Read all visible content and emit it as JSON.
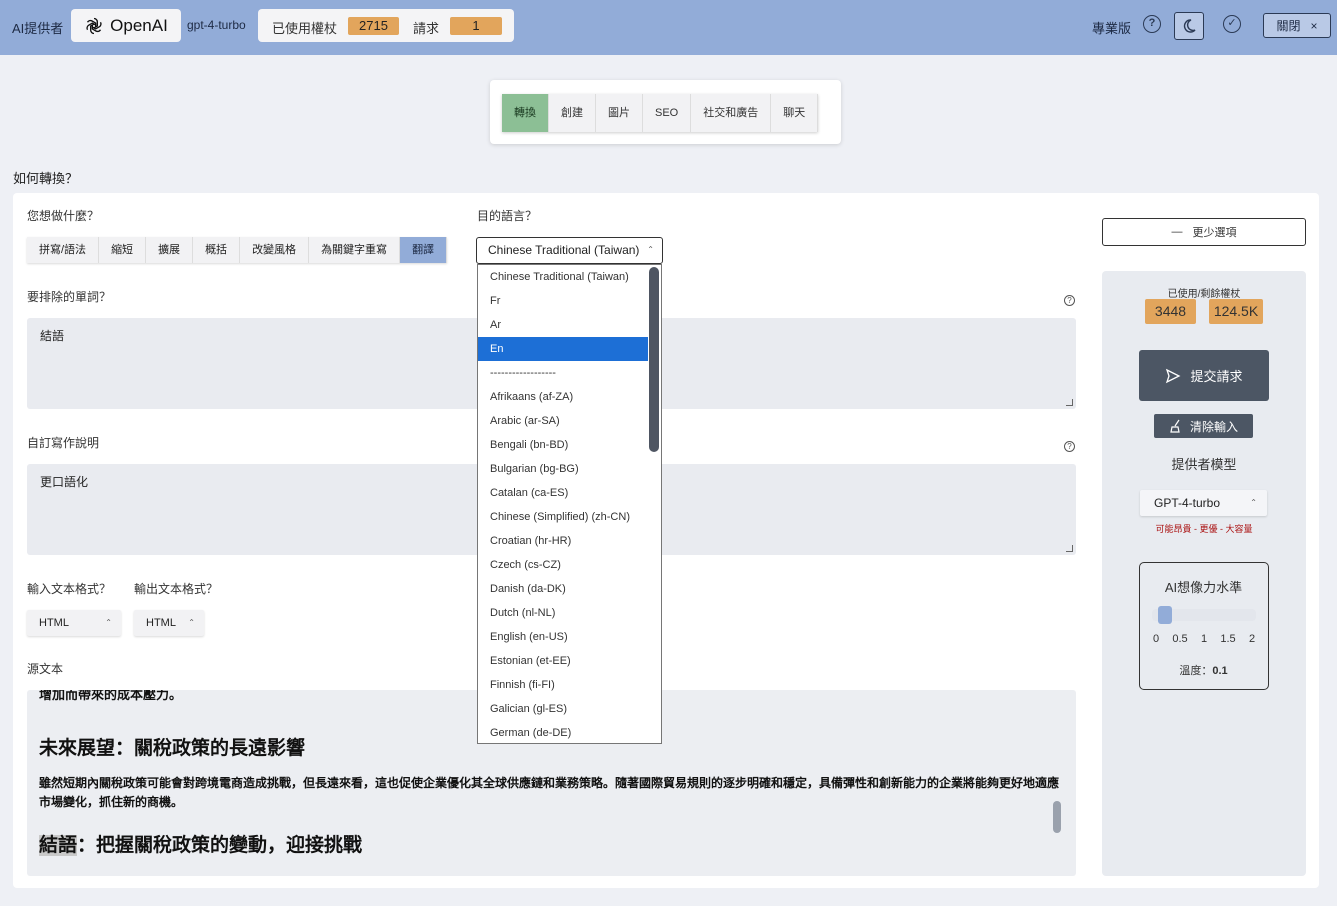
{
  "header": {
    "provider_label": "AI提供者",
    "provider_name": "OpenAI",
    "model": "gpt-4-turbo",
    "tokens_label": "已使用權杖",
    "tokens_value": "2715",
    "requests_label": "請求",
    "requests_value": "1",
    "plan": "專業版",
    "close_label": "關閉",
    "close_icon": "×"
  },
  "tabs": [
    "轉換",
    "創建",
    "圖片",
    "SEO",
    "社交和廣告",
    "聊天"
  ],
  "main": {
    "question": "如何轉換？",
    "action_label": "您想做什麼？",
    "actions": [
      "拼寫/語法",
      "縮短",
      "擴展",
      "概括",
      "改變風格",
      "為關鍵字重寫",
      "翻譯"
    ],
    "active_action": "翻譯",
    "target_lang_label": "目的語言？",
    "target_lang_value": "Chinese Traditional (Taiwan)",
    "exclude_label": "要排除的單詞？",
    "exclude_value": "結語",
    "custom_label": "自訂寫作說明",
    "custom_value": "更口語化",
    "input_format_label": "輸入文本格式？",
    "output_format_label": "輸出文本格式？",
    "input_format": "HTML",
    "output_format": "HTML",
    "source_label": "源文本",
    "source": {
      "cut_line": "增加而帶來的成本壓力。",
      "heading1": "未來展望：關稅政策的長遠影響",
      "paragraph": "雖然短期內關稅政策可能會對跨境電商造成挑戰，但長遠來看，這也促使企業優化其全球供應鏈和業務策略。隨著國際貿易規則的逐步明確和穩定，具備彈性和創新能力的企業將能夠更好地適應市場變化，抓住新的商機。",
      "heading2_highlight": "結語",
      "heading2_rest": "：把握關稅政策的變動，迎接挑戰"
    }
  },
  "dropdown": {
    "options": [
      "Chinese Traditional (Taiwan)",
      "Fr",
      "Ar",
      "En",
      "------------------",
      "Afrikaans (af-ZA)",
      "Arabic (ar-SA)",
      "Bengali (bn-BD)",
      "Bulgarian (bg-BG)",
      "Catalan (ca-ES)",
      "Chinese (Simplified) (zh-CN)",
      "Croatian (hr-HR)",
      "Czech (cs-CZ)",
      "Danish (da-DK)",
      "Dutch (nl-NL)",
      "English (en-US)",
      "Estonian (et-EE)",
      "Finnish (fi-FI)",
      "Galician (gl-ES)",
      "German (de-DE)"
    ],
    "highlighted": "En"
  },
  "side": {
    "less_options": "更少選項",
    "usage_title": "已使用/剩餘權杖",
    "used": "3448",
    "remaining": "124.5K",
    "submit": "提交請求",
    "clear": "清除輸入",
    "model_label": "提供者模型",
    "model_value": "GPT-4-turbo",
    "model_note": "可能昂貴 - 更優 - 大容量",
    "imagination_title": "AI想像力水準",
    "slider_ticks": [
      "0",
      "0.5",
      "1",
      "1.5",
      "2"
    ],
    "slider_value": 0.1,
    "temp_label": "溫度：",
    "temp_value": "0.1"
  },
  "colors": {
    "topbar": "#92acd8",
    "accent_orange": "#e2a55c",
    "active_tab": "#8cbf95",
    "dropdown_highlight": "#1d6fd6"
  }
}
